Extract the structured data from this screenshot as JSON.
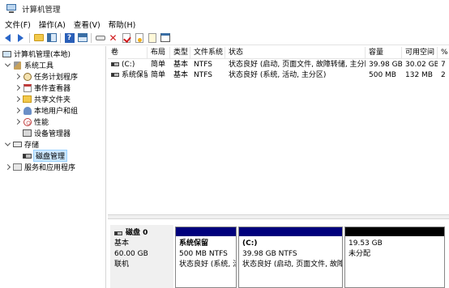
{
  "window": {
    "title": "计算机管理"
  },
  "menu": [
    "文件(F)",
    "操作(A)",
    "查看(V)",
    "帮助(H)"
  ],
  "toolbar": {
    "buttons": [
      "back-icon",
      "forward-icon",
      "up-folder-icon",
      "show-hide-pane-icon",
      "help-icon",
      "action-pane-icon",
      "connect-icon",
      "delete-icon",
      "properties-icon",
      "new-icon",
      "import-icon",
      "export-list-icon"
    ]
  },
  "tree": {
    "root": "计算机管理(本地)",
    "system_tools": "系统工具",
    "task_scheduler": "任务计划程序",
    "event_viewer": "事件查看器",
    "shared_folders": "共享文件夹",
    "local_users": "本地用户和组",
    "performance": "性能",
    "device_manager": "设备管理器",
    "storage": "存储",
    "disk_management": "磁盘管理",
    "services": "服务和应用程序"
  },
  "volumes": {
    "columns": [
      "卷",
      "布局",
      "类型",
      "文件系统",
      "状态",
      "容量",
      "可用空间",
      "%"
    ],
    "rows": [
      {
        "vol": "(C:)",
        "layout": "简单",
        "type": "基本",
        "fs": "NTFS",
        "status": "状态良好 (启动, 页面文件, 故障转储, 主分区)",
        "capacity": "39.98 GB",
        "free": "30.02 GB",
        "pct": "7"
      },
      {
        "vol": "系统保留",
        "layout": "简单",
        "type": "基本",
        "fs": "NTFS",
        "status": "状态良好 (系统, 活动, 主分区)",
        "capacity": "500 MB",
        "free": "132 MB",
        "pct": "2"
      }
    ]
  },
  "disk": {
    "name": "磁盘 0",
    "type": "基本",
    "size": "60.00 GB",
    "state": "联机",
    "partitions": [
      {
        "name": "系统保留",
        "size": "500 MB NTFS",
        "status": "状态良好 (系统, 活",
        "bar_color": "#00007c"
      },
      {
        "name": "(C:)",
        "size": "39.98 GB NTFS",
        "status": "状态良好 (启动, 页面文件, 故障",
        "bar_color": "#00007c"
      },
      {
        "name": "",
        "size": "19.53 GB",
        "status": "未分配",
        "bar_color": "#000000"
      }
    ]
  }
}
